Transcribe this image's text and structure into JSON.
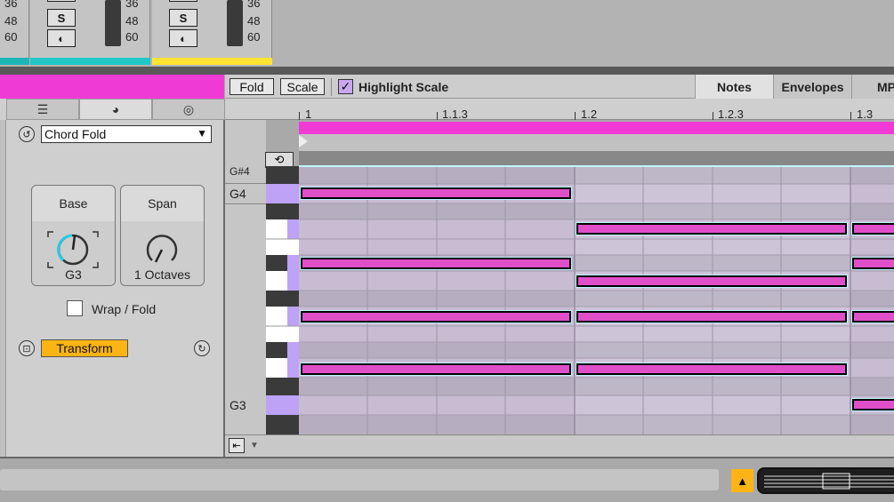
{
  "mixer": {
    "db_ticks": [
      "36",
      "48",
      "60"
    ],
    "strips": [
      {
        "solo_label": "S",
        "color": "#22c6c6"
      },
      {
        "solo_label": "S",
        "color": "#ffe433"
      }
    ],
    "left_color": "#1db5b5"
  },
  "device": {
    "mode": "Chord Fold",
    "knobs": [
      {
        "label": "Base",
        "value": "G3"
      },
      {
        "label": "Span",
        "value": "1 Octaves"
      }
    ],
    "wrap_fold_label": "Wrap / Fold",
    "transform_label": "Transform",
    "knob_accent": "#27c9e6",
    "icons": [
      "sliders-icon",
      "dice-icon",
      "target-icon"
    ]
  },
  "editor": {
    "fold_label": "Fold",
    "scale_label": "Scale",
    "highlight_scale_label": "Highlight Scale",
    "highlight_scale_checked": true,
    "tabs": [
      "Notes",
      "Envelopes",
      "MP"
    ],
    "ruler_labels": [
      "1",
      "1.1.3",
      "1.2",
      "1.2.3",
      "1.3"
    ],
    "pitch_labels": {
      "top": "G#4",
      "g4": "G4",
      "g3": "G3"
    },
    "loop_color": "#f03ad6",
    "note_color": "#e04fc8"
  },
  "status": {
    "warning_icon": "warning-icon"
  }
}
